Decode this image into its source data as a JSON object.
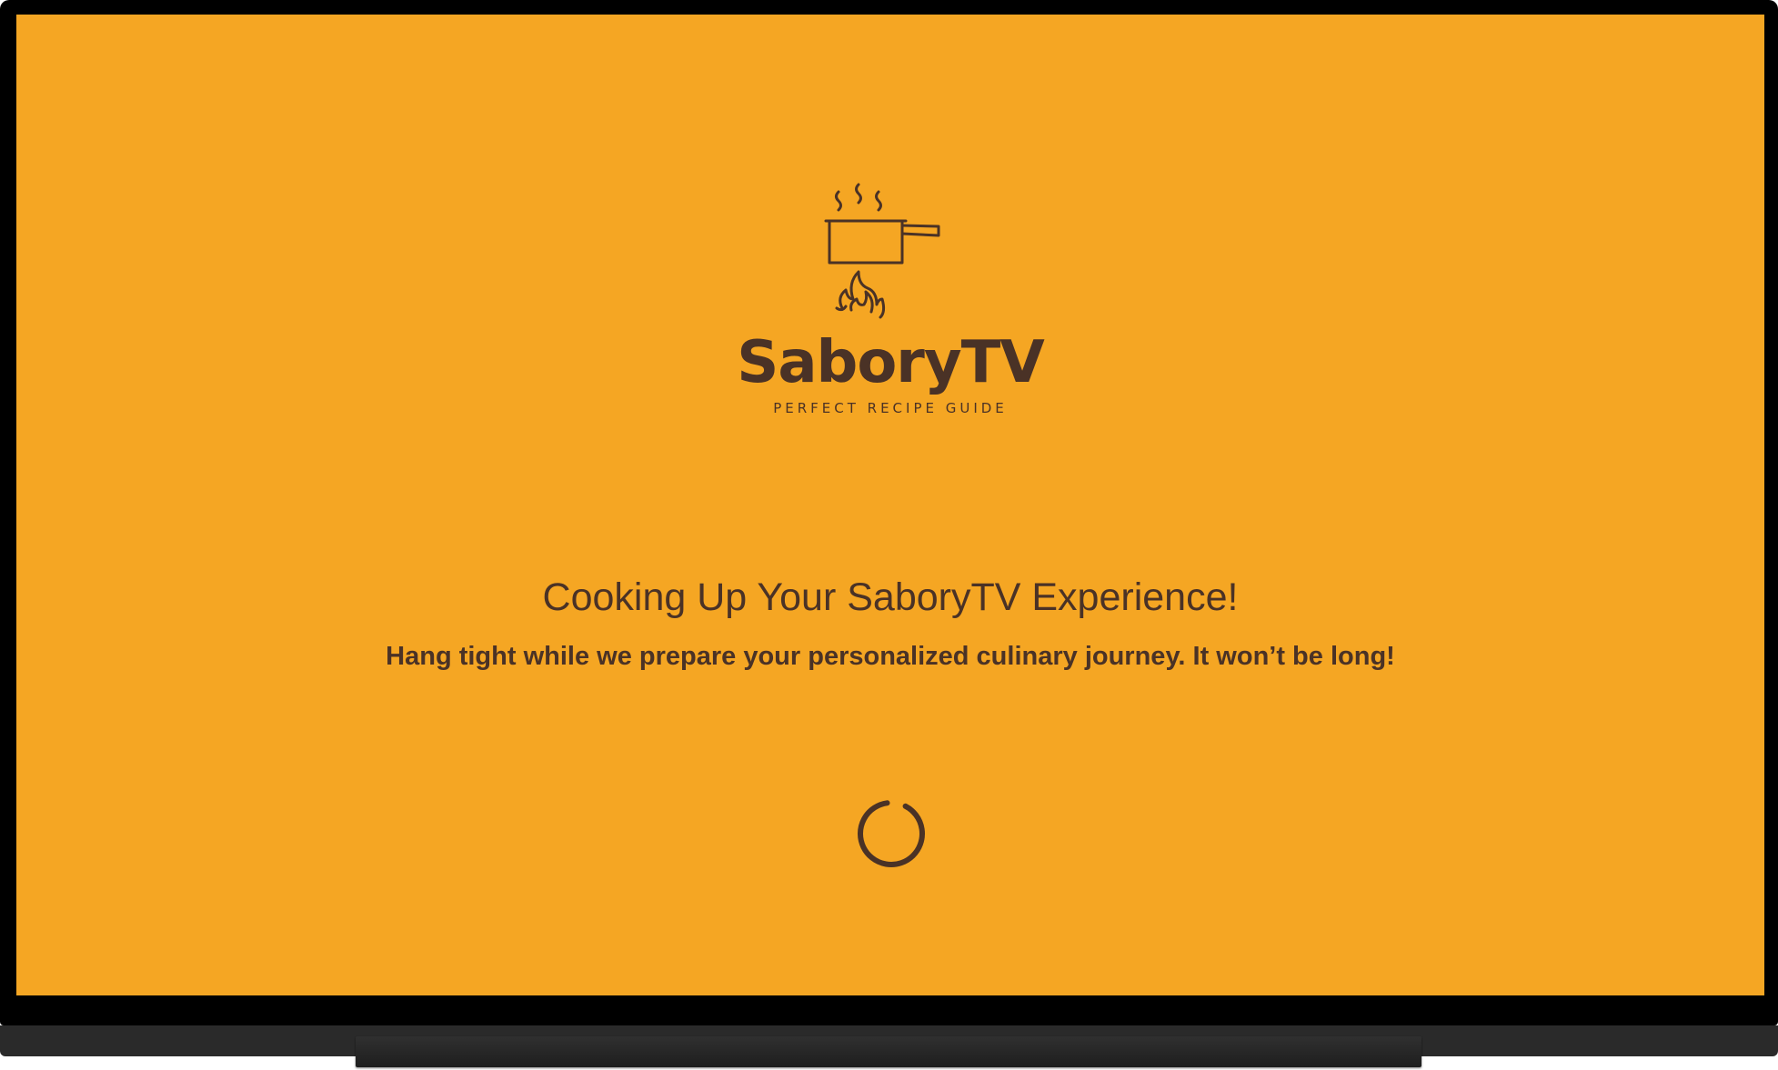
{
  "app": {
    "brand_name": "SaboryTV",
    "tagline": "PERFECT RECIPE GUIDE"
  },
  "loading": {
    "headline": "Cooking Up Your SaboryTV Experience!",
    "message": "Hang tight while we prepare your personalized culinary journey. It won’t be long!"
  },
  "icons": {
    "logo": "cooking-pot-on-flame-icon",
    "spinner": "loading-spinner-icon"
  },
  "colors": {
    "background": "#F5A623",
    "foreground": "#4A3226",
    "tv_frame": "#000000"
  }
}
